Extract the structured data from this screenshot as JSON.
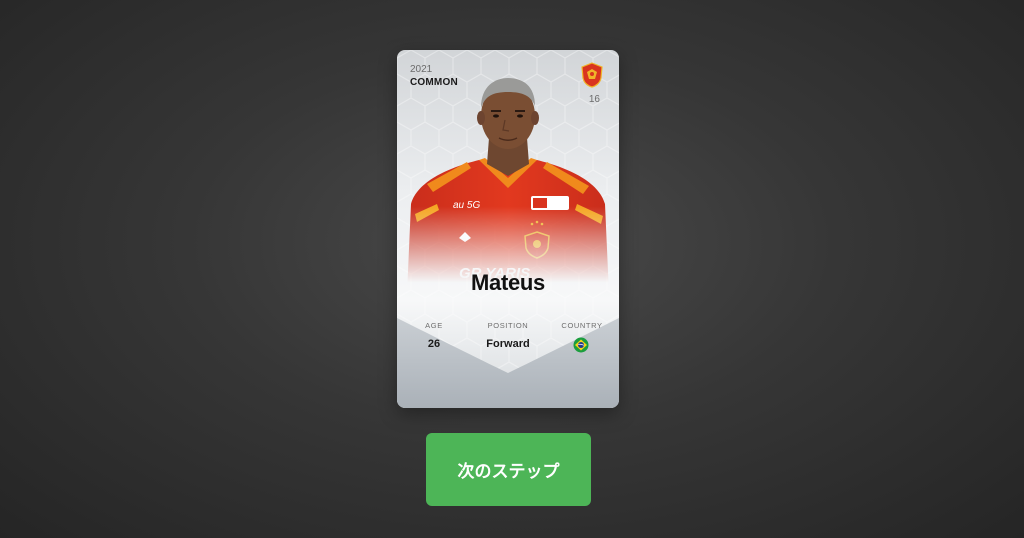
{
  "card": {
    "season": "2021",
    "rarity": "COMMON",
    "serial_number": "16",
    "club_crest_icon": "club-crest-icon",
    "player_name": "Mateus",
    "shirt_sponsor": "GR YARIS",
    "stats": {
      "age_label": "AGE",
      "age_value": "26",
      "position_label": "POSITION",
      "position_value": "Forward",
      "country_label": "COUNTRY",
      "country_flag_icon": "brazil-flag-icon"
    },
    "colors": {
      "jersey_red": "#d9341f",
      "jersey_orange": "#f08a1c"
    }
  },
  "actions": {
    "next_step_label": "次のステップ",
    "accent": "#4db557"
  }
}
